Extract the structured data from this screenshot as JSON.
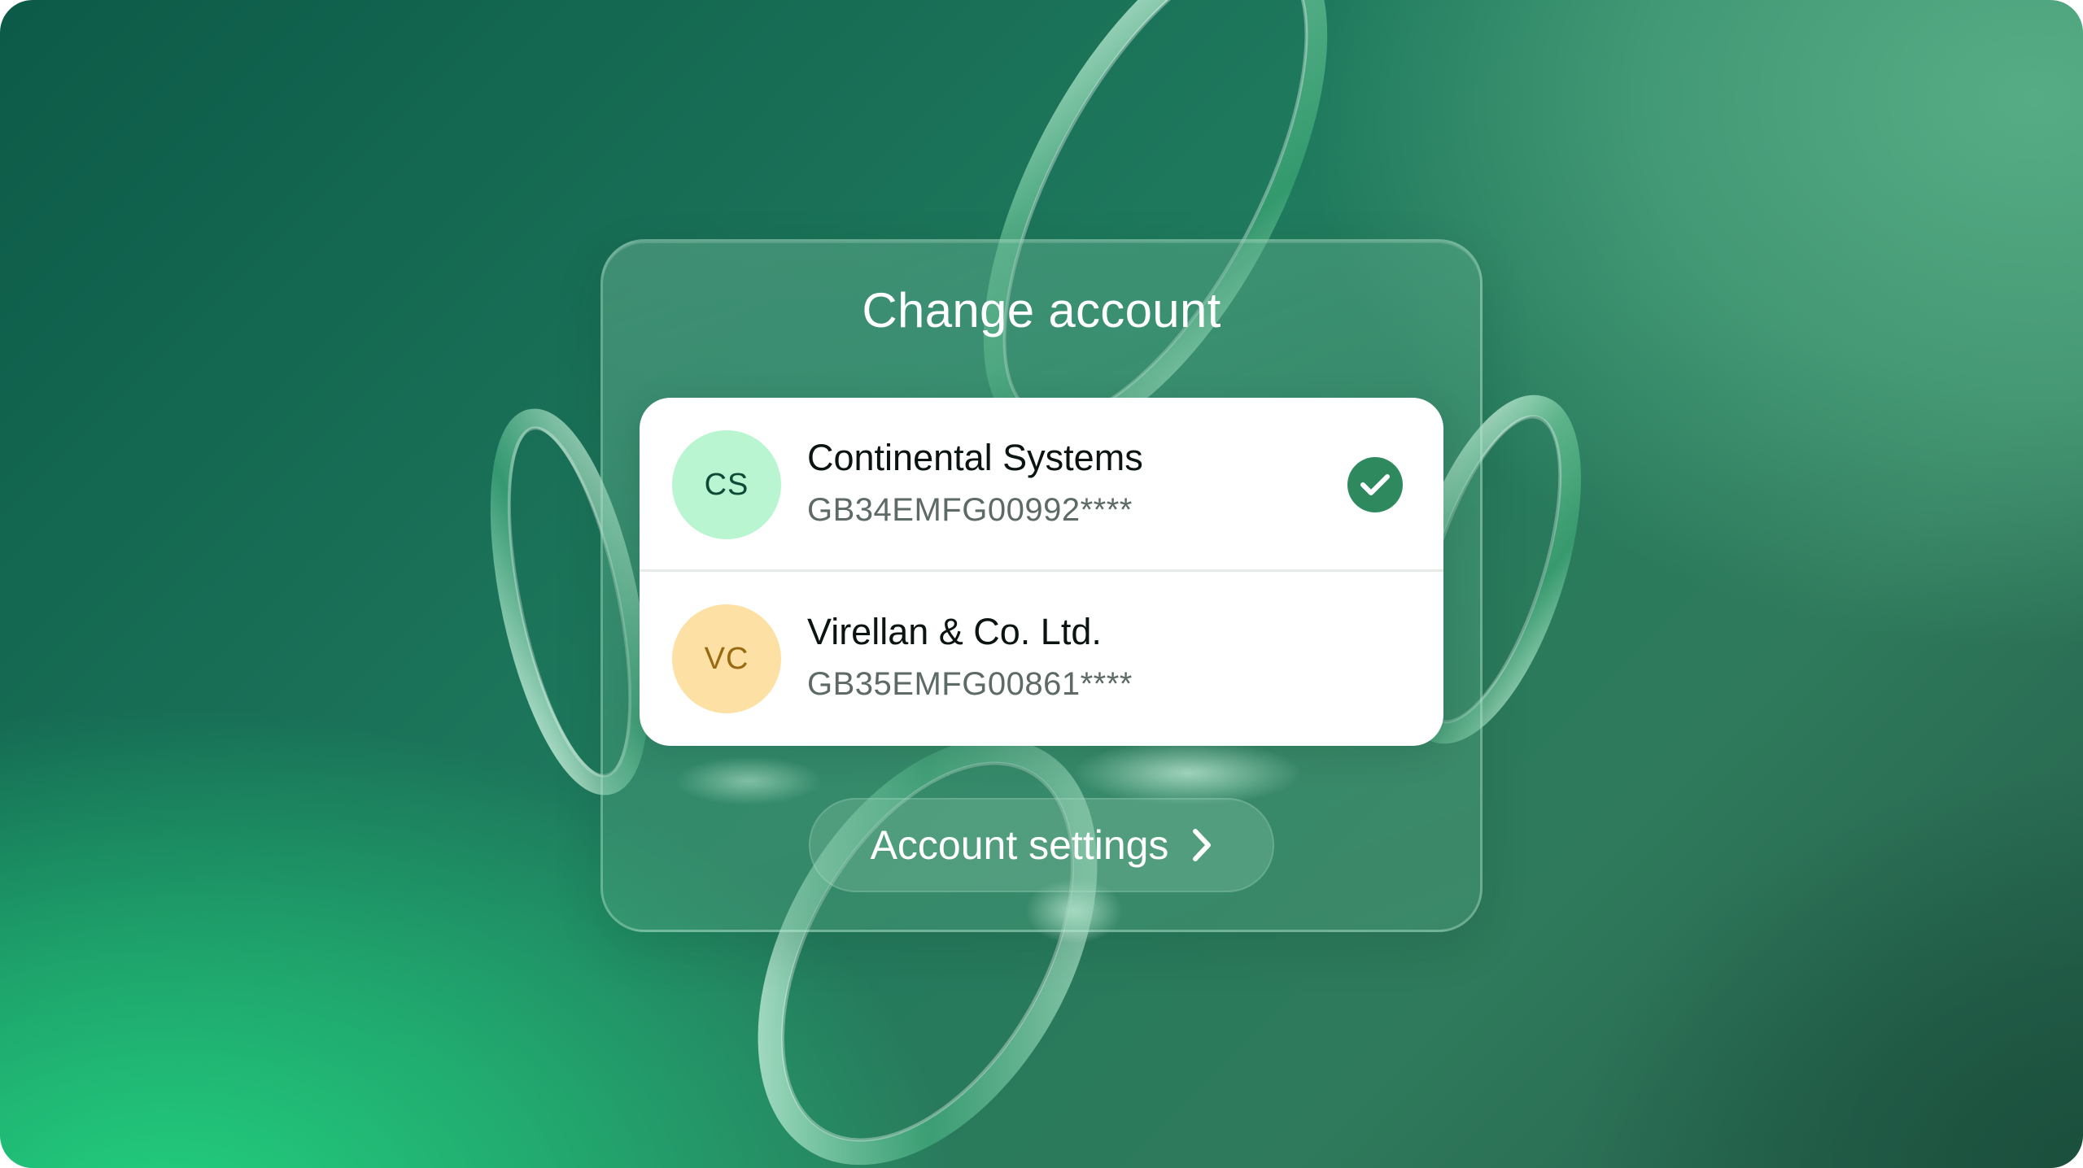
{
  "panel": {
    "title": "Change account"
  },
  "accounts": [
    {
      "initials": "CS",
      "name": "Continental Systems",
      "iban": "GB34EMFG00992****",
      "selected": true,
      "avatar_bg": "#b8f5d0",
      "avatar_fg": "#0e4a38"
    },
    {
      "initials": "VC",
      "name": "Virellan & Co. Ltd.",
      "iban": "GB35EMFG00861****",
      "selected": false,
      "avatar_bg": "#fde0a3",
      "avatar_fg": "#9a6a12"
    }
  ],
  "settings_button": {
    "label": "Account settings",
    "icon": "chevron-right-icon"
  },
  "colors": {
    "accent": "#2e8a5e",
    "background_dark": "#0c5a48",
    "background_bright": "#22d07e"
  },
  "icons": {
    "selected": "check-circle-icon"
  }
}
